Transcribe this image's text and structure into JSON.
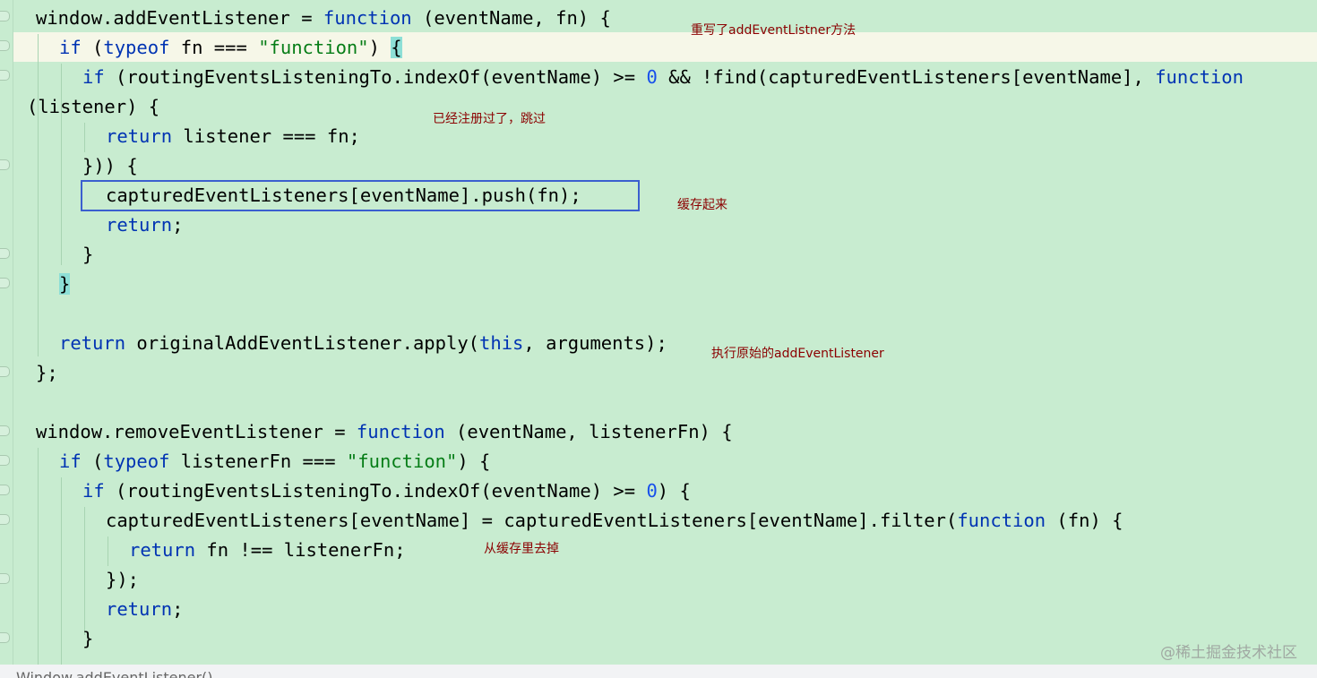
{
  "code": {
    "lines": [
      [
        "window.addEventListener = ",
        "function",
        " (eventName, fn) {"
      ],
      [
        "if",
        " (",
        "typeof",
        " fn === ",
        "\"function\"",
        ") ",
        "{"
      ],
      [
        "if",
        " (routingEventsListeningTo.indexOf(eventName) >= ",
        "0",
        " && !find(capturedEventListeners[eventName], ",
        "function"
      ],
      [
        "(listener) {"
      ],
      [
        "return",
        " listener === fn;"
      ],
      [
        "})) {"
      ],
      [
        "capturedEventListeners[eventName].push(fn);"
      ],
      [
        "return",
        ";"
      ],
      [
        "}"
      ],
      [
        "}"
      ],
      [
        ""
      ],
      [
        "return",
        " originalAddEventListener.apply(",
        "this",
        ", arguments);"
      ],
      [
        "};"
      ],
      [
        ""
      ],
      [
        "window.removeEventListener = ",
        "function",
        " (eventName, listenerFn) {"
      ],
      [
        "if",
        " (",
        "typeof",
        " listenerFn === ",
        "\"function\"",
        ") {"
      ],
      [
        "if",
        " (routingEventsListeningTo.indexOf(eventName) >= ",
        "0",
        ") {"
      ],
      [
        "capturedEventListeners[eventName] = capturedEventListeners[eventName].filter(",
        "function",
        " (fn) {"
      ],
      [
        "return",
        " fn !== listenerFn;"
      ],
      [
        "});"
      ],
      [
        "return",
        ";"
      ],
      [
        "}"
      ]
    ]
  },
  "annotations": {
    "override": "重写了addEventListner方法",
    "already_registered": "已经注册过了，跳过",
    "cache": "缓存起来",
    "execute_original": "执行原始的addEventListener",
    "remove_from_cache": "从缓存里去掉"
  },
  "bottom_bar": {
    "text": "Window.addEventListener()"
  },
  "watermark": "@稀土掘金技术社区",
  "colors": {
    "background": "#c8ecd0",
    "keyword": "#0033b3",
    "string": "#067d17",
    "number": "#1750eb",
    "annotation": "#8b0000",
    "box_border": "#3b5fcf"
  }
}
